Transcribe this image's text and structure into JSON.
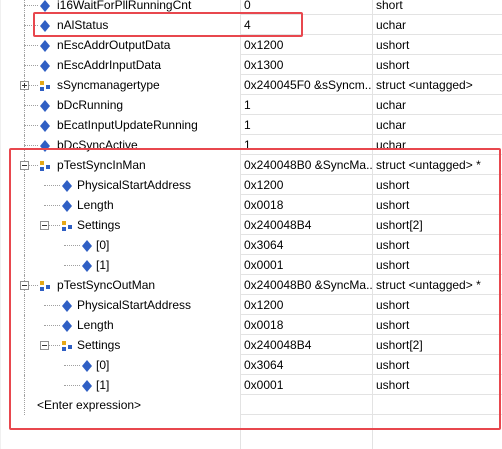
{
  "colors": {
    "highlight": "#e8474e",
    "icon_blue": "#2f5fc4",
    "icon_gold": "#e6a817"
  },
  "rows": [
    {
      "name": "i16WaitForPllRunningCnt",
      "value": "0",
      "type": "short",
      "icon": "field-icon"
    },
    {
      "name": "nAlStatus",
      "value": "4",
      "type": "uchar",
      "icon": "field-icon"
    },
    {
      "name": "nEscAddrOutputData",
      "value": "0x1200",
      "type": "ushort",
      "icon": "field-icon"
    },
    {
      "name": "nEscAddrInputData",
      "value": "0x1300",
      "type": "ushort",
      "icon": "field-icon"
    },
    {
      "name": "sSyncmanagertype",
      "value": "0x240045F0 &sSyncm...",
      "type": "struct <untagged>",
      "icon": "struct-icon"
    },
    {
      "name": "bDcRunning",
      "value": "1",
      "type": "uchar",
      "icon": "field-icon"
    },
    {
      "name": "bEcatInputUpdateRunning",
      "value": "1",
      "type": "uchar",
      "icon": "field-icon"
    },
    {
      "name": "bDcSyncActive",
      "value": "1",
      "type": "uchar",
      "icon": "field-icon"
    },
    {
      "name": "pTestSyncInMan",
      "value": "0x240048B0 &SyncMa...",
      "type": "struct <untagged> *",
      "icon": "struct-icon"
    },
    {
      "name": "PhysicalStartAddress",
      "value": "0x1200",
      "type": "ushort",
      "icon": "field-icon"
    },
    {
      "name": "Length",
      "value": "0x0018",
      "type": "ushort",
      "icon": "field-icon"
    },
    {
      "name": "Settings",
      "value": "0x240048B4",
      "type": "ushort[2]",
      "icon": "struct-icon"
    },
    {
      "name": "[0]",
      "value": "0x3064",
      "type": "ushort",
      "icon": "field-icon"
    },
    {
      "name": "[1]",
      "value": "0x0001",
      "type": "ushort",
      "icon": "field-icon"
    },
    {
      "name": "pTestSyncOutMan",
      "value": "0x240048B0 &SyncMa...",
      "type": "struct <untagged> *",
      "icon": "struct-icon"
    },
    {
      "name": "PhysicalStartAddress",
      "value": "0x1200",
      "type": "ushort",
      "icon": "field-icon"
    },
    {
      "name": "Length",
      "value": "0x0018",
      "type": "ushort",
      "icon": "field-icon"
    },
    {
      "name": "Settings",
      "value": "0x240048B4",
      "type": "ushort[2]",
      "icon": "struct-icon"
    },
    {
      "name": "[0]",
      "value": "0x3064",
      "type": "ushort",
      "icon": "field-icon"
    },
    {
      "name": "[1]",
      "value": "0x0001",
      "type": "ushort",
      "icon": "field-icon"
    },
    {
      "name": "<Enter expression>",
      "value": "",
      "type": "",
      "icon": ""
    }
  ]
}
